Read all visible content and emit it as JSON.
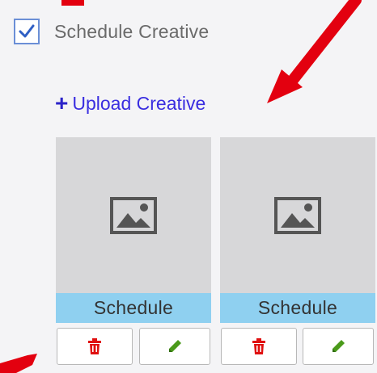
{
  "schedule_creative": {
    "checked": true,
    "label": "Schedule Creative"
  },
  "upload": {
    "label": "Upload Creative",
    "icon": "plus-icon"
  },
  "creatives": [
    {
      "thumbnail_icon": "image-placeholder-icon",
      "schedule_label": "Schedule",
      "delete_icon": "trash-icon",
      "edit_icon": "pencil-icon"
    },
    {
      "thumbnail_icon": "image-placeholder-icon",
      "schedule_label": "Schedule",
      "delete_icon": "trash-icon",
      "edit_icon": "pencil-icon"
    }
  ],
  "colors": {
    "link": "#3a2ee0",
    "checkbox_border": "#6b8fd6",
    "schedule_bar": "#8fd0f0",
    "thumbnail_bg": "#d7d7d9",
    "delete_icon": "#e01010",
    "edit_icon": "#4a9a1a",
    "annotation_arrow": "#e3000f"
  }
}
